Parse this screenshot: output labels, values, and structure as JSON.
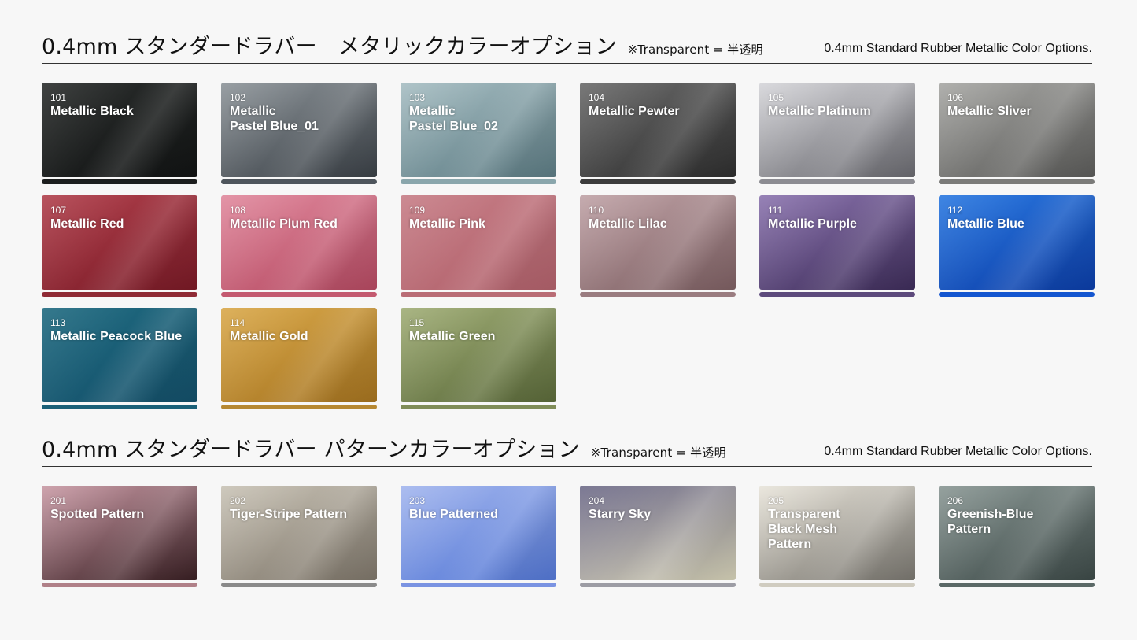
{
  "section1": {
    "title": "0.4mm スタンダードラバー　メタリックカラーオプション",
    "note": "※Transparent = 半透明",
    "title_en": "0.4mm  Standard Rubber Metallic Color Options."
  },
  "section2": {
    "title": "0.4mm スタンダードラバー パターンカラーオプション",
    "note": "※Transparent = 半透明",
    "title_en": "0.4mm  Standard Rubber Metallic Color Options."
  },
  "metallic": [
    {
      "code": "101",
      "name": "Metallic Black",
      "c1": "#2a2d2c",
      "c2": "#121414",
      "bar": "#1c1e1e"
    },
    {
      "code": "102",
      "name": "Metallic\nPastel Blue_01",
      "c1": "#8d9499",
      "c2": "#3b4147",
      "bar": "#4e555c"
    },
    {
      "code": "103",
      "name": "Metallic\nPastel Blue_02",
      "c1": "#a6bdc2",
      "c2": "#5d7c84",
      "bar": "#8aa6ac"
    },
    {
      "code": "104",
      "name": "Metallic Pewter",
      "c1": "#6a6a6a",
      "c2": "#2f2f2f",
      "bar": "#3c3c3c"
    },
    {
      "code": "105",
      "name": "Metallic Platinum",
      "c1": "#d5d5d9",
      "c2": "#6a6a70",
      "bar": "#8c8c92"
    },
    {
      "code": "106",
      "name": "Metallic Sliver",
      "c1": "#a7a7a4",
      "c2": "#5c5c5a",
      "bar": "#7b7b79"
    },
    {
      "code": "107",
      "name": "Metallic Red",
      "c1": "#b0404c",
      "c2": "#7a1a26",
      "bar": "#8f2a35"
    },
    {
      "code": "108",
      "name": "Metallic Plum Red",
      "c1": "#e0899d",
      "c2": "#b64a62",
      "bar": "#c45a70"
    },
    {
      "code": "109",
      "name": "Metallic Pink",
      "c1": "#c67d86",
      "c2": "#b2626c",
      "bar": "#b96c75"
    },
    {
      "code": "110",
      "name": "Metallic Lilac",
      "c1": "#bfa2a6",
      "c2": "#7e6063",
      "bar": "#9a7c80"
    },
    {
      "code": "111",
      "name": "Metallic Purple",
      "c1": "#8b74ae",
      "c2": "#3e2d5a",
      "bar": "#5d4a7c"
    },
    {
      "code": "112",
      "name": "Metallic Blue",
      "c1": "#2a78e0",
      "c2": "#0c3ea8",
      "bar": "#1456d0"
    },
    {
      "code": "113",
      "name": "Metallic Peacock Blue",
      "c1": "#1f6a80",
      "c2": "#14506a",
      "bar": "#1a6078"
    },
    {
      "code": "114",
      "name": "Metallic Gold",
      "c1": "#d9a84a",
      "c2": "#a67420",
      "bar": "#b68832"
    },
    {
      "code": "115",
      "name": "Metallic Green",
      "c1": "#a0ad76",
      "c2": "#5b6a3a",
      "bar": "#7f8c58"
    }
  ],
  "pattern": [
    {
      "code": "201",
      "name": "Spotted Pattern",
      "c1": "#c99aa5",
      "c2": "#3a2024",
      "bar": "#b08088"
    },
    {
      "code": "202",
      "name": "Tiger-Stripe Pattern",
      "c1": "#c9c3b6",
      "c2": "#7e766a",
      "bar": "#8a8a8a"
    },
    {
      "code": "203",
      "name": "Blue Patterned",
      "c1": "#a3b6ee",
      "c2": "#5478d6",
      "bar": "#7a93e2"
    },
    {
      "code": "204",
      "name": "Starry Sky",
      "c1": "#6d6a88",
      "c2": "#d6d2b8",
      "bar": "#9c9ca4"
    },
    {
      "code": "205",
      "name": "Transparent\nBlack Mesh\nPattern",
      "c1": "#e8e4da",
      "c2": "#7a7770",
      "bar": "#d0ccc0"
    },
    {
      "code": "206",
      "name": "Greenish-Blue\nPattern",
      "c1": "#8a9794",
      "c2": "#3d4a48",
      "bar": "#5a6866"
    }
  ]
}
